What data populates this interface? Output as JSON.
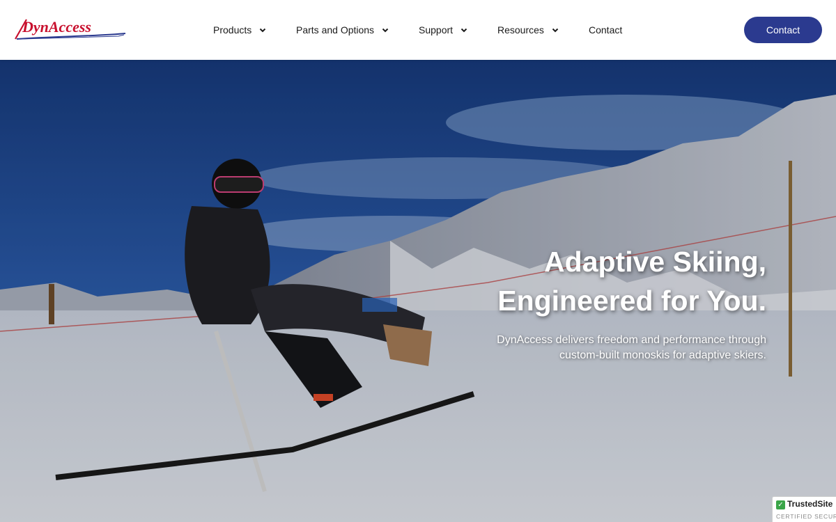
{
  "brand": {
    "logo_text": "DynAccess",
    "accent": "#2b3a8f",
    "logo_red": "#c8102e"
  },
  "nav": {
    "items": [
      {
        "label": "Products",
        "has_dropdown": true
      },
      {
        "label": "Parts and Options",
        "has_dropdown": true
      },
      {
        "label": "Support",
        "has_dropdown": true
      },
      {
        "label": "Resources",
        "has_dropdown": true
      },
      {
        "label": "Contact",
        "has_dropdown": false
      }
    ],
    "cta_label": "Contact"
  },
  "hero": {
    "title_line1": "Adaptive Skiing,",
    "title_line2": "Engineered for You.",
    "subtitle": "DynAccess delivers freedom and performance through custom-built monoskis for adaptive skiers.",
    "image": "adaptive-skier-on-monoski-snowy-mountain"
  },
  "trust_badge": {
    "brand": "TrustedSite",
    "sub": "CERTIFIED SECURE",
    "icon": "check-icon"
  }
}
